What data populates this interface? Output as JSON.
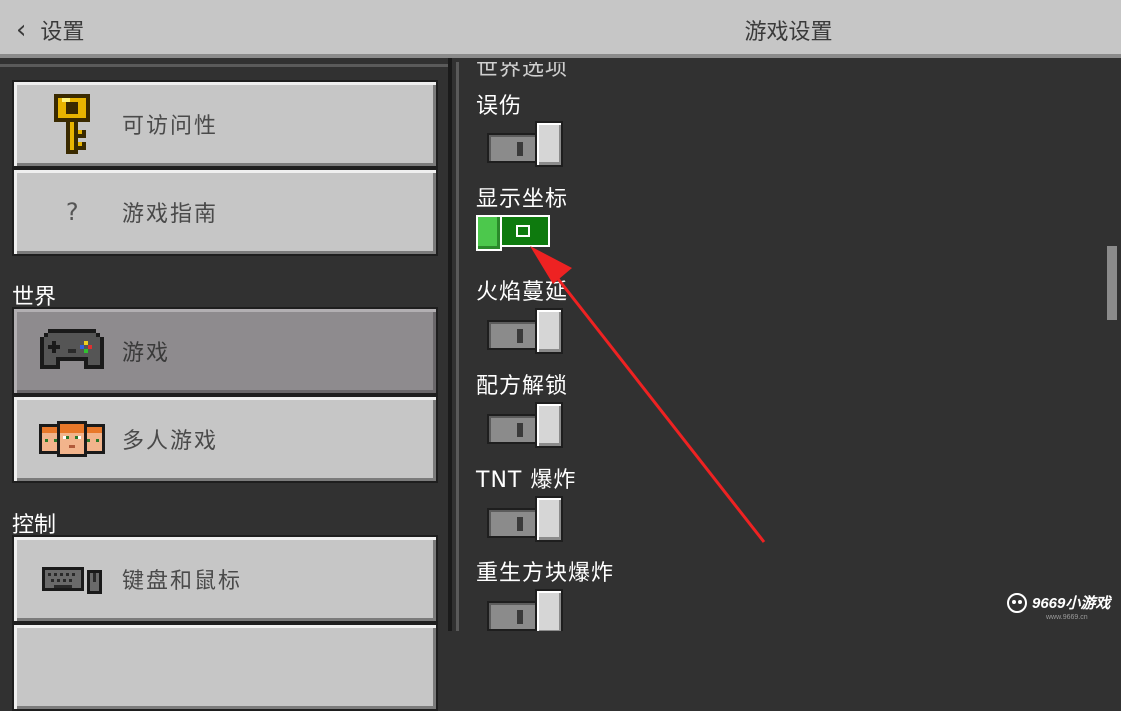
{
  "header": {
    "back_icon": "chevron-left-icon",
    "back_label": "设置",
    "title": "游戏设置"
  },
  "sidebar": {
    "items_top": [
      {
        "label": "可访问性",
        "icon": "key-icon"
      },
      {
        "label": "游戏指南",
        "icon": "question-icon",
        "glyph": "?"
      }
    ],
    "sections": [
      {
        "title": "世界",
        "items": [
          {
            "label": "游戏",
            "icon": "controller-icon",
            "selected": true
          },
          {
            "label": "多人游戏",
            "icon": "players-icon"
          }
        ]
      },
      {
        "title": "控制",
        "items": [
          {
            "label": "键盘和鼠标",
            "icon": "keyboard-mouse-icon"
          }
        ]
      }
    ]
  },
  "settings": [
    {
      "label": "误伤",
      "on": false
    },
    {
      "label": "显示坐标",
      "on": true
    },
    {
      "label": "火焰蔓延",
      "on": false
    },
    {
      "label": "配方解锁",
      "on": false
    },
    {
      "label": "TNT 爆炸",
      "on": false
    },
    {
      "label": "重生方块爆炸",
      "on": false
    }
  ],
  "annotation": {
    "color": "#ee2222"
  },
  "watermark": {
    "brand": "9669小游戏",
    "url": "www.9669.cn"
  },
  "colors": {
    "button_gray": "#c6c6c6",
    "selected_gray": "#8e8b8e",
    "toggle_on": "#0e7a0e",
    "background": "#313131"
  }
}
